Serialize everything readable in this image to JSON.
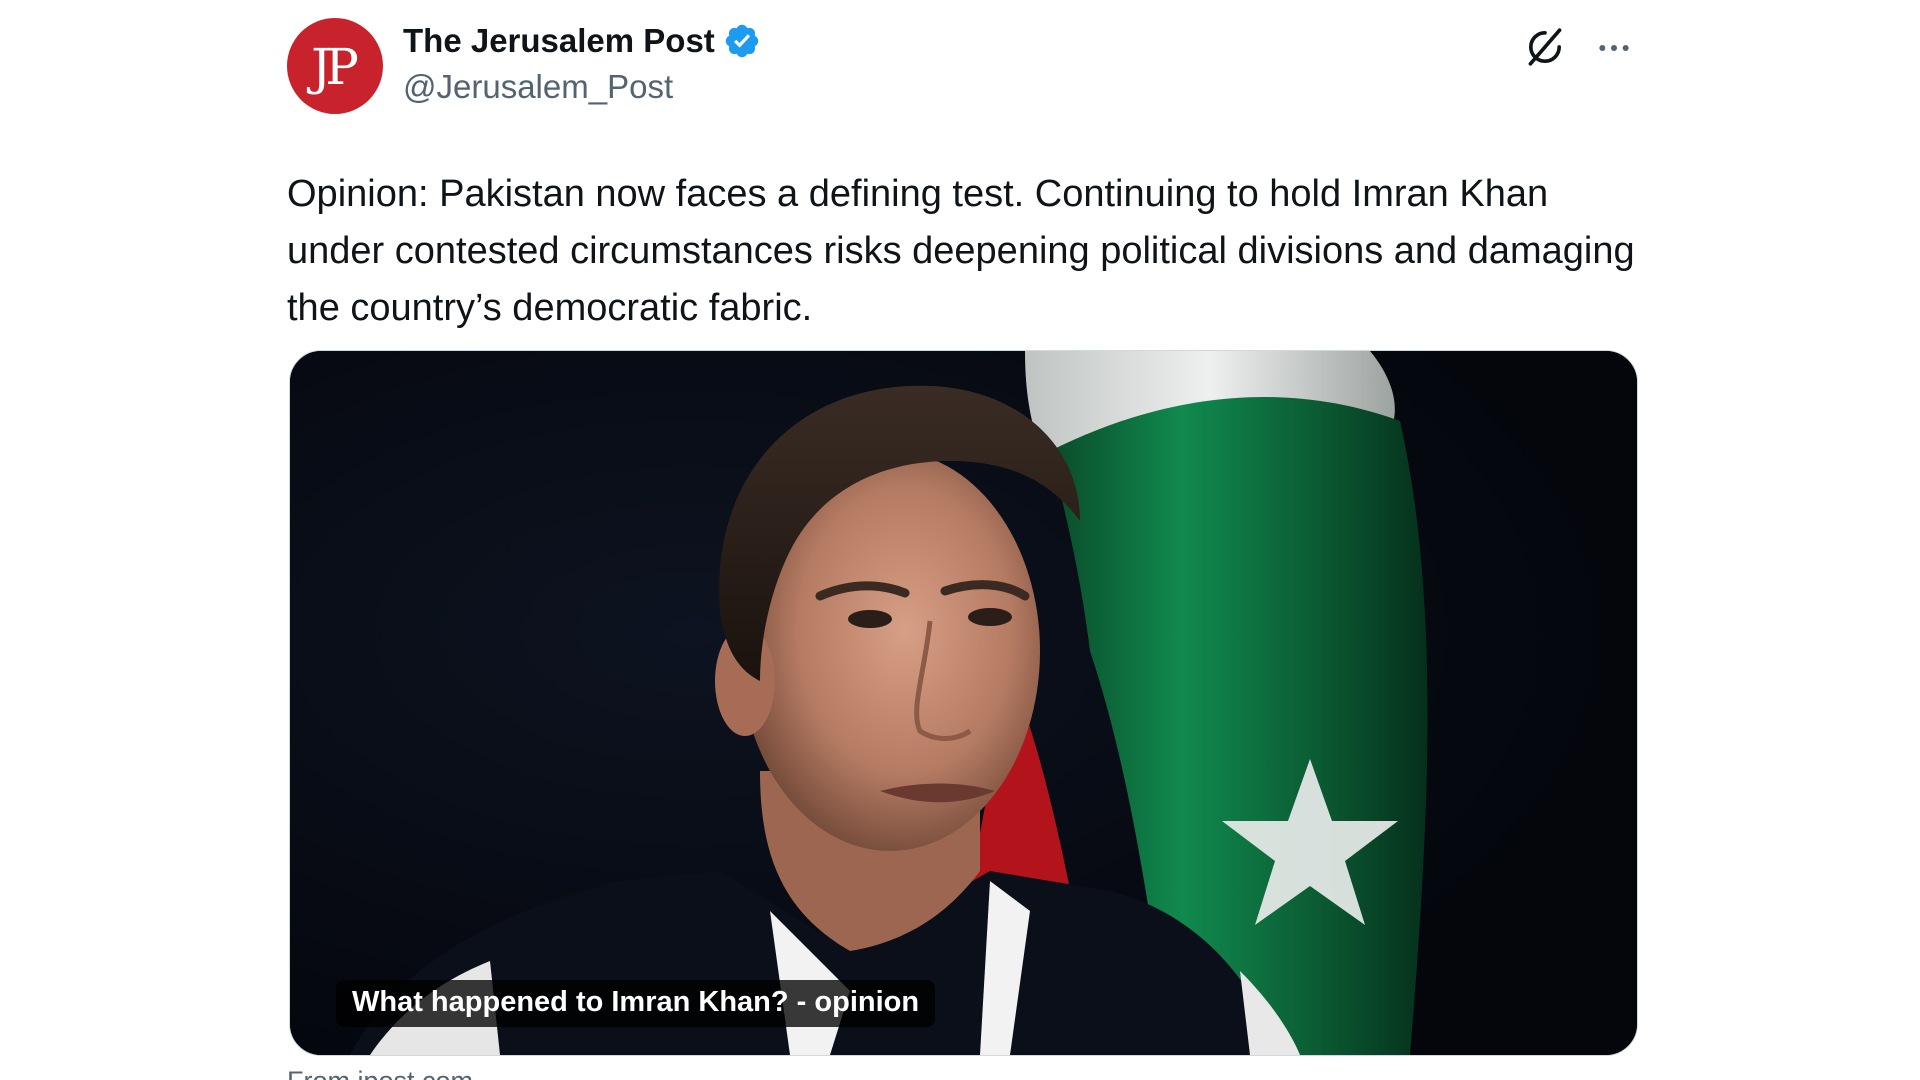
{
  "author": {
    "display_name": "The Jerusalem Post",
    "handle": "@Jerusalem_Post",
    "avatar_text": "JP",
    "verified": true
  },
  "tweet": {
    "text": "Opinion: Pakistan now faces a defining test. Continuing to hold Imran Khan under contested circumstances risks deepening political divisions and damaging the country’s democratic fabric."
  },
  "card": {
    "caption": "What happened to Imran Khan? - opinion",
    "source": "From jpost.com"
  },
  "icons": {
    "verified": "verified-badge-icon",
    "grok": "grok-icon",
    "more": "more-options-icon"
  },
  "colors": {
    "verified_blue": "#1d9bf0",
    "avatar_red": "#c8232c",
    "handle_gray": "#536471",
    "flag_green": "#0d6b3b"
  }
}
